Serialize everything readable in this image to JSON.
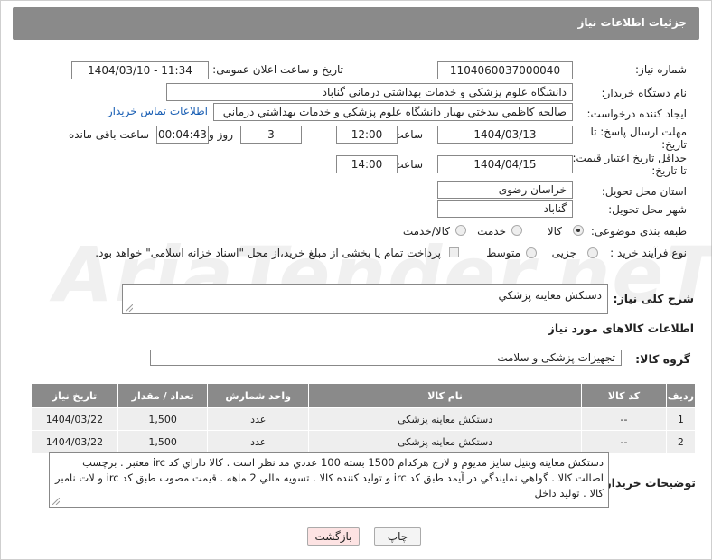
{
  "header": {
    "title": "جزئیات اطلاعات نیاز"
  },
  "watermark": "AriaTender.neT",
  "fields": {
    "need_number": {
      "label": "شماره نیاز:",
      "value": "1104060037000040"
    },
    "announce": {
      "label": "تاریخ و ساعت اعلان عمومی:",
      "value": "1404/03/10 - 11:34"
    },
    "buyer_org": {
      "label": "نام دستگاه خریدار:",
      "value": "دانشگاه علوم پزشكي و خدمات بهداشتي درماني گناباد"
    },
    "requester": {
      "label": "ایجاد کننده درخواست:",
      "value": "صالحه كاظمي بيدختي بهيار دانشگاه علوم پزشكي و خدمات بهداشتي درماني",
      "contact_link": "اطلاعات تماس خریدار"
    },
    "deadline": {
      "label1": "مهلت ارسال پاسخ: تا",
      "label2": "تاریخ:",
      "date": "1404/03/13",
      "time_label": "ساعت",
      "time": "12:00",
      "days": "3",
      "days_label": "روز و",
      "remaining": "00:04:43",
      "remaining_label": "ساعت باقی مانده"
    },
    "validity": {
      "label1": "حداقل تاریخ اعتبار قیمت:",
      "label2": "تا تاریخ:",
      "date": "1404/04/15",
      "time_label": "ساعت",
      "time": "14:00"
    },
    "delivery_province": {
      "label": "استان محل تحویل:",
      "value": "خراسان رضوی"
    },
    "delivery_city": {
      "label": "شهر محل تحویل:",
      "value": "گناباد"
    },
    "category": {
      "label": "طبقه بندی موضوعی:",
      "options": [
        "کالا",
        "خدمت",
        "کالا/خدمت"
      ]
    },
    "process": {
      "label": "نوع فرآیند خرید :",
      "options": [
        "جزیی",
        "متوسط"
      ],
      "note": "پرداخت تمام یا بخشی از مبلغ خرید،از محل \"اسناد خزانه اسلامی\" خواهد بود."
    }
  },
  "summary": {
    "label": "شرح کلی نیاز:",
    "value": "دستكش معاينه پزشكي"
  },
  "goods_section_title": "اطلاعات کالاهای مورد نیاز",
  "goods_group": {
    "label": "گروه کالا:",
    "value": "تجهیزات پزشکی و سلامت"
  },
  "table": {
    "headers": [
      "ردیف",
      "کد کالا",
      "نام کالا",
      "واحد شمارش",
      "تعداد / مقدار",
      "تاریخ نیاز"
    ],
    "rows": [
      [
        "1",
        "--",
        "دستکش معاینه پزشکی",
        "عدد",
        "1,500",
        "1404/03/22"
      ],
      [
        "2",
        "--",
        "دستکش معاینه پزشکی",
        "عدد",
        "1,500",
        "1404/03/22"
      ]
    ]
  },
  "buyer_notes": {
    "label": "توضیحات خریدار:",
    "value": "دستكش معاينه وينيل  سايز مديوم و لارج هركدام 1500 بسته 100 عددي مد نظر است . كالا داراي كد irc معتبر .  برچسب اصالت كالا . گواهي نمايندگي در آيمد طبق كد irc و توليد كننده كالا . تسويه مالي 2 ماهه . قيمت مصوب طبق كد irc و لات نامبر كالا . توليد داخل"
  },
  "buttons": {
    "print": "چاپ",
    "back": "بازگشت"
  },
  "colors": {
    "header_bg": "#8a8a8a",
    "link": "#1a5fb4",
    "print_bg": "#f4f4f4",
    "back_bg": "#fde3e3"
  }
}
